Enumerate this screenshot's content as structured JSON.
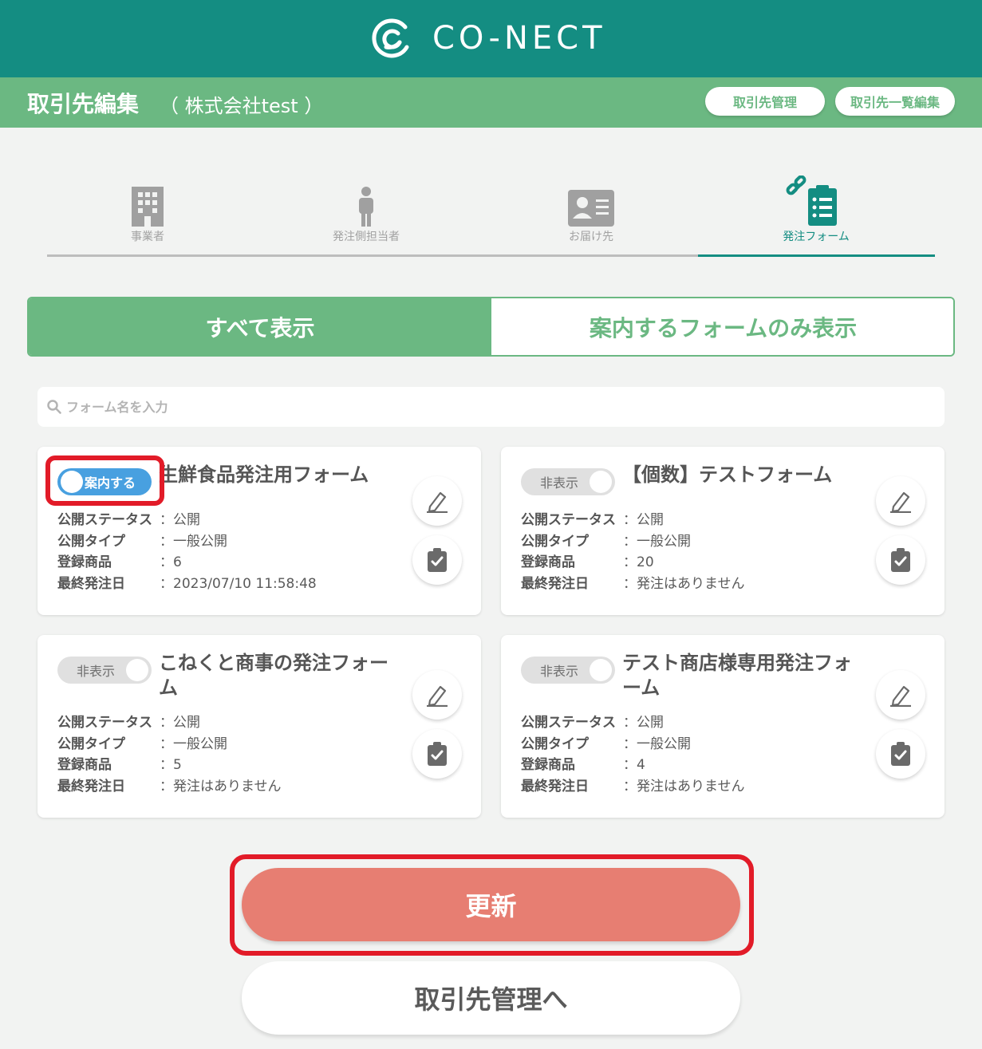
{
  "header": {
    "brand": "CO-NECT",
    "logo_icon": "conect-logo-icon",
    "accent_color": "#148d82"
  },
  "subheader": {
    "title": "取引先編集",
    "company": "（ 株式会社test ）",
    "buttons": [
      "取引先管理",
      "取引先一覧編集"
    ],
    "bg_color": "#6bb882"
  },
  "steps": [
    {
      "label": "事業者",
      "icon": "building-icon",
      "active": false
    },
    {
      "label": "発注側担当者",
      "icon": "person-icon",
      "active": false
    },
    {
      "label": "お届け先",
      "icon": "contact-card-icon",
      "active": false
    },
    {
      "label": "発注フォーム",
      "icon": "clipboard-list-icon",
      "active": true
    }
  ],
  "filter_tabs": {
    "all": "すべて表示",
    "guided_only": "案内するフォームのみ表示",
    "selected": "all"
  },
  "search": {
    "placeholder": "フォーム名を入力",
    "value": ""
  },
  "info_labels": {
    "status": "公開ステータス",
    "type": "公開タイプ",
    "products": "登録商品",
    "last_order": "最終発注日"
  },
  "cards": [
    {
      "toggle": "案内する",
      "toggle_on": true,
      "name": "生鮮食品発注用フォーム",
      "status": "：公開",
      "type": "：一般公開",
      "products": "：6",
      "last_order": "：2023/07/10 11:58:48"
    },
    {
      "toggle": "非表示",
      "toggle_on": false,
      "name": "【個数】テストフォーム",
      "status": "：公開",
      "type": "：一般公開",
      "products": "：20",
      "last_order": "：発注はありません"
    },
    {
      "toggle": "非表示",
      "toggle_on": false,
      "name": "こねくと商事の発注フォーム",
      "status": "：公開",
      "type": "：一般公開",
      "products": "：5",
      "last_order": "：発注はありません"
    },
    {
      "toggle": "非表示",
      "toggle_on": false,
      "name": "テスト商店様専用発注フォーム",
      "status": "：公開",
      "type": "：一般公開",
      "products": "：4",
      "last_order": "：発注はありません"
    }
  ],
  "actions": {
    "update": "更新",
    "back": "取引先管理へ",
    "update_color": "#e77e72",
    "highlight_color": "#e21b28"
  }
}
